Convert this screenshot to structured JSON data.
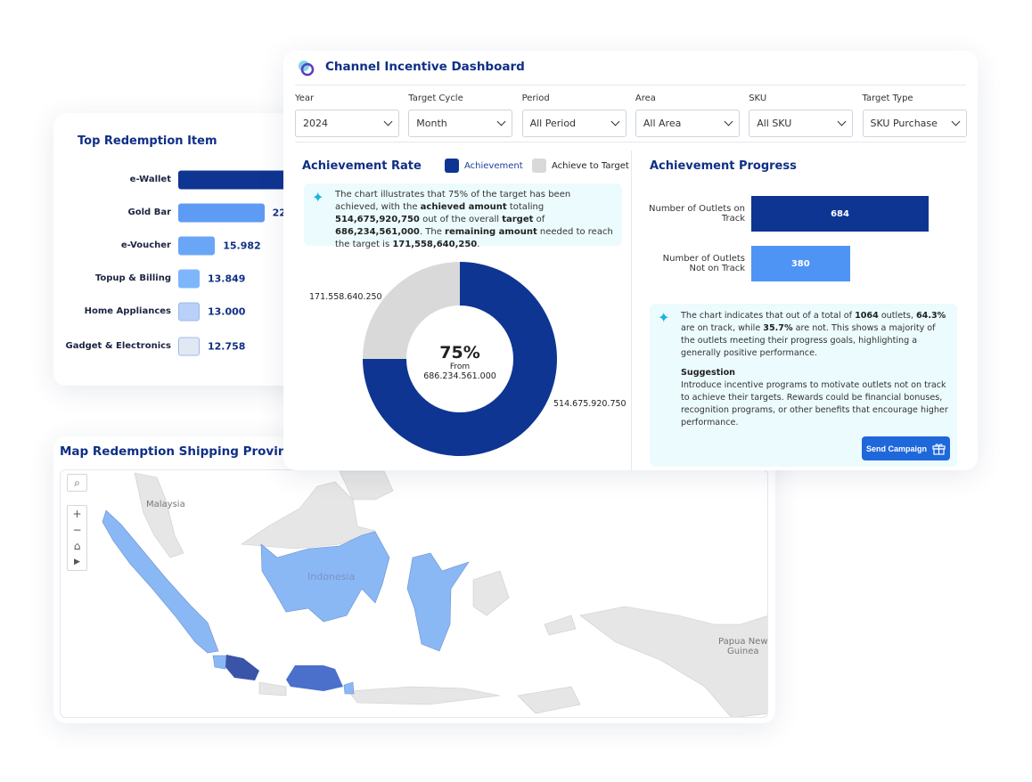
{
  "top_redemption": {
    "title": "Top Redemption Item",
    "items": [
      {
        "label": "e-Wallet",
        "value_text": "",
        "color": "#0f3592",
        "value": null
      },
      {
        "label": "Gold Bar",
        "value_text": "22.",
        "color": "#5d9bf5",
        "value": 22
      },
      {
        "label": "e-Voucher",
        "value_text": "15.982",
        "color": "#6aa6f7",
        "value": 15.982
      },
      {
        "label": "Topup & Billing",
        "value_text": "13.849",
        "color": "#7db6fb",
        "value": 13.849
      },
      {
        "label": "Home Appliances",
        "value_text": "13.000",
        "color": "#b9d0f9",
        "value": 13.0
      },
      {
        "label": "Gadget & Electronics",
        "value_text": "12.758",
        "color": "#e2e8f3",
        "value": 12.758
      }
    ]
  },
  "dashboard": {
    "title": "Channel Incentive Dashboard",
    "filters": [
      {
        "label": "Year",
        "value": "2024"
      },
      {
        "label": "Target Cycle",
        "value": "Month"
      },
      {
        "label": "Period",
        "value": "All Period"
      },
      {
        "label": "Area",
        "value": "All Area"
      },
      {
        "label": "SKU",
        "value": "All SKU"
      },
      {
        "label": "Target Type",
        "value": "SKU Purchase"
      }
    ],
    "achievement_rate": {
      "title": "Achievement Rate",
      "legend": [
        {
          "label": "Achievement",
          "color": "#0f3592"
        },
        {
          "label": "Achieve to Target",
          "color": "#d9d9d9"
        }
      ],
      "insight": {
        "t1": "The chart illustrates that 75% of the target has been achieved, with the ",
        "b1": "achieved amount",
        "t2": " totaling ",
        "b2": "514,675,920,750",
        "t3": " out of the overall ",
        "b3": "target",
        "t4": " of ",
        "b4": "686,234,561,000",
        "t5": ". The ",
        "b5": "remaining amount",
        "t6": " needed to reach the target is ",
        "b6": "171,558,640,250",
        "t7": "."
      },
      "center_pct": "75%",
      "center_from": "From",
      "center_total": "686.234.561.000",
      "achieved_label": "514.675.920.750",
      "remaining_label": "171.558.640.250",
      "achieved_pct": 75
    },
    "progress": {
      "title": "Achievement Progress",
      "bars": [
        {
          "label": "Number of Outlets on Track",
          "value": 684,
          "value_text": "684",
          "color": "#0f3592"
        },
        {
          "label": "Number of Outlets Not on Track",
          "value": 380,
          "value_text": "380",
          "color": "#4d94f5"
        }
      ],
      "insight": {
        "t1": "The chart indicates that out of a total of ",
        "b1": "1064",
        "t2": " outlets, ",
        "b2": "64.3%",
        "t3": " are on track, while ",
        "b3": "35.7%",
        "t4": " are not. This shows a majority of the outlets meeting their progress goals, highlighting a generally positive performance."
      },
      "suggestion_title": "Suggestion",
      "suggestion": "Introduce incentive programs to motivate outlets not on track to achieve their targets. Rewards could be financial bonuses, recognition programs, or other benefits that encourage higher performance.",
      "button": "Send Campaign"
    }
  },
  "map": {
    "title": "Map Redemption Shipping Provinc",
    "labels": {
      "malaysia": "Malaysia",
      "indonesia": "Indonesia",
      "png": "Papua New Guinea"
    },
    "colors": {
      "low": "#8ab8f5",
      "mid": "#4a70cc",
      "high": "#3a55a8",
      "land": "#e6e6e6"
    },
    "controls": {
      "search": "⌕",
      "zoom_in": "+",
      "zoom_out": "−",
      "home": "⌂",
      "play": "▶"
    }
  }
}
